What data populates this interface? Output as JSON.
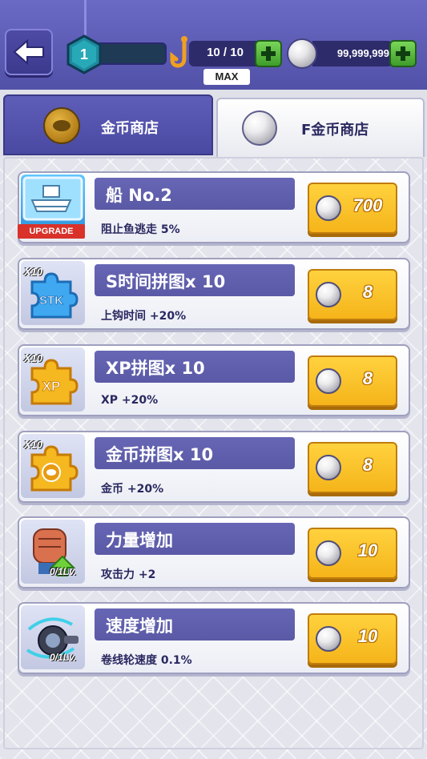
{
  "header": {
    "level": "1",
    "stamina": "10 / 10",
    "stamina_max_label": "MAX",
    "pearls": "99,999,999"
  },
  "tabs": [
    {
      "label": "金币商店",
      "selected": false
    },
    {
      "label": "F金币商店",
      "selected": true
    }
  ],
  "items": [
    {
      "name": "船 No.2",
      "desc": "阻止鱼逃走 5%",
      "price": "700",
      "badge": "UPGRADE",
      "icon": "boat-icon"
    },
    {
      "name": "S时间拼图x 10",
      "desc": "上钩时间 +20%",
      "price": "8",
      "badge": "X10",
      "icon": "stk-puzzle-icon"
    },
    {
      "name": "XP拼图x 10",
      "desc": "XP +20%",
      "price": "8",
      "badge": "X10",
      "icon": "xp-puzzle-icon"
    },
    {
      "name": "金币拼图x 10",
      "desc": "金币 +20%",
      "price": "8",
      "badge": "X10",
      "icon": "coin-puzzle-icon"
    },
    {
      "name": "力量增加",
      "desc": "攻击力 +2",
      "price": "10",
      "badge": "0/1Lv.",
      "icon": "fist-icon"
    },
    {
      "name": "速度增加",
      "desc": "卷线轮速度 0.1%",
      "price": "10",
      "badge": "0/1Lv.",
      "icon": "reel-icon"
    }
  ],
  "colors": {
    "header_bg": "#5b5ab3",
    "price_button": "#f8c12a",
    "name_box": "#5f5eab"
  }
}
